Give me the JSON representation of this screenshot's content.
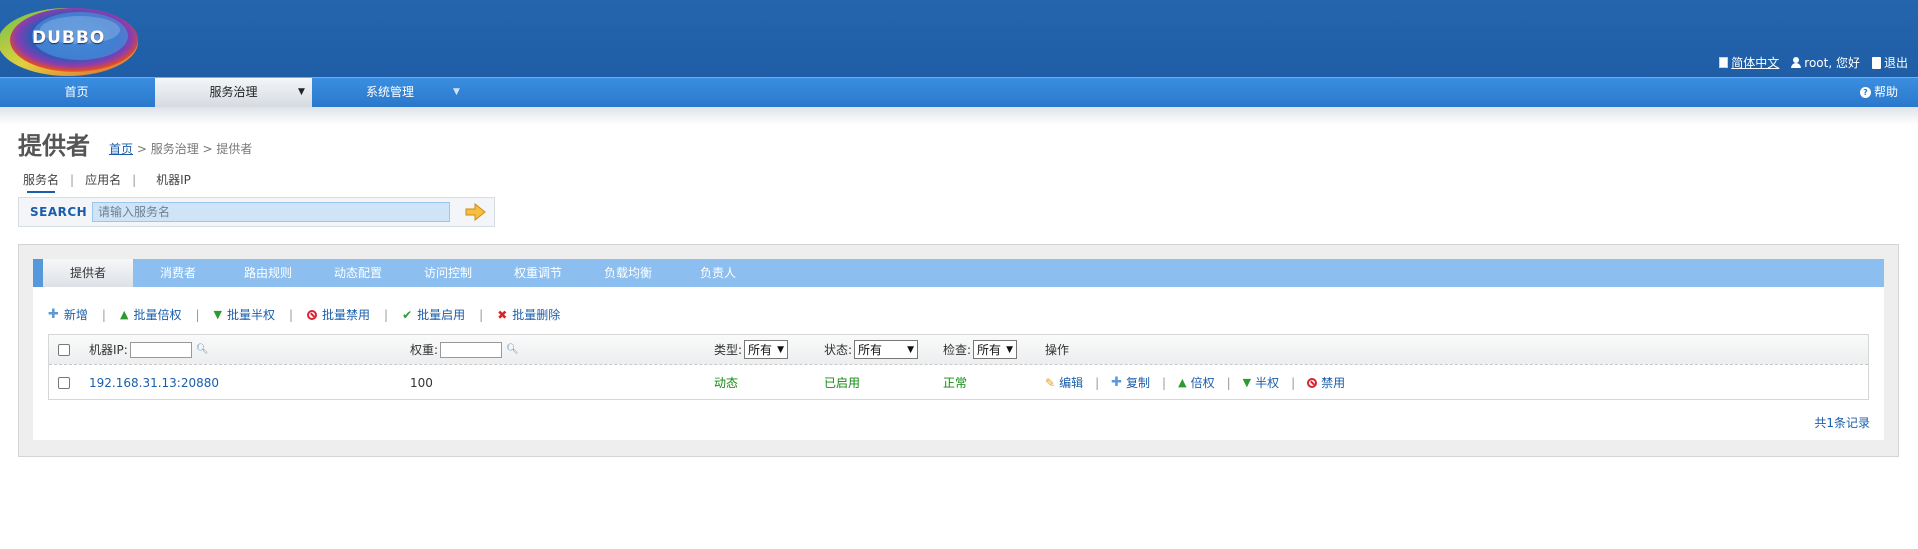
{
  "header": {
    "logo_text": "DUBBO",
    "links": {
      "language": "简体中文",
      "user": "root, 您好",
      "logout": "退出"
    }
  },
  "nav": {
    "items": [
      {
        "label": "首页"
      },
      {
        "label": "服务治理"
      },
      {
        "label": "系统管理"
      }
    ],
    "help": "帮助"
  },
  "page": {
    "title": "提供者",
    "breadcrumb": {
      "home": "首页",
      "rest": " > 服务治理 > 提供者"
    }
  },
  "search": {
    "tabs": [
      "服务名",
      "应用名",
      "机器IP"
    ],
    "active_tab": "服务名",
    "label": "SEARCH",
    "placeholder": "请输入服务名"
  },
  "tabs": [
    "提供者",
    "消费者",
    "路由规则",
    "动态配置",
    "访问控制",
    "权重调节",
    "负载均衡",
    "负责人"
  ],
  "toolbar": {
    "add": "新增",
    "double": "批量倍权",
    "half": "批量半权",
    "disable": "批量禁用",
    "enable": "批量启用",
    "delete": "批量删除"
  },
  "table": {
    "headers": {
      "ip": "机器IP:",
      "weight": "权重:",
      "type": "类型:",
      "type_value": "所有",
      "status": "状态:",
      "status_value": "所有",
      "check": "检查:",
      "check_value": "所有",
      "ops": "操作"
    },
    "rows": [
      {
        "ip": "192.168.31.13:20880",
        "weight": "100",
        "type": "动态",
        "status": "已启用",
        "check": "正常",
        "ops": {
          "edit": "编辑",
          "copy": "复制",
          "double": "倍权",
          "half": "半权",
          "disable": "禁用"
        }
      }
    ],
    "total": "共1条记录"
  },
  "colors": {
    "header": "#2262aa",
    "nav": "#2f82d6",
    "tabbar": "#8cbff0",
    "link": "#1a5eab",
    "ok": "#128b12"
  },
  "icons": [
    "document-icon",
    "user-icon",
    "logout-icon",
    "help-icon",
    "arrow-right-icon",
    "plus-icon",
    "arrow-up-icon",
    "arrow-down-icon",
    "ban-icon",
    "check-icon",
    "x-icon",
    "pencil-icon",
    "magnifier-icon"
  ]
}
